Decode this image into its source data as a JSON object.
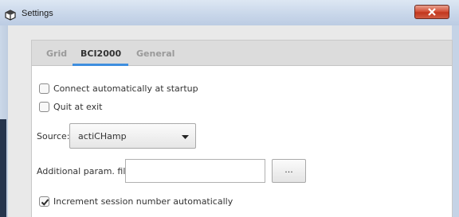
{
  "window": {
    "title": "Settings",
    "close_glyph": "x",
    "icons": {
      "app": "settings-app-icon",
      "close": "close-icon"
    }
  },
  "tabs": [
    {
      "label": "Grid",
      "active": false
    },
    {
      "label": "BCI2000",
      "active": true
    },
    {
      "label": "General",
      "active": false
    }
  ],
  "options": {
    "connect_auto": {
      "label": "Connect automatically at startup",
      "checked": false
    },
    "quit_at_exit": {
      "label": "Quit at exit",
      "checked": false
    },
    "increment_session": {
      "label": "Increment session number automatically",
      "checked": true
    }
  },
  "source": {
    "label": "Source:",
    "value": "actiCHamp",
    "arrow_icon": "dropdown-arrow-icon"
  },
  "param_file": {
    "label": "Additional param. file:",
    "value": "",
    "browse_label": "..."
  },
  "colors": {
    "accent": "#3e8ede",
    "close_button": "#c2361d"
  }
}
